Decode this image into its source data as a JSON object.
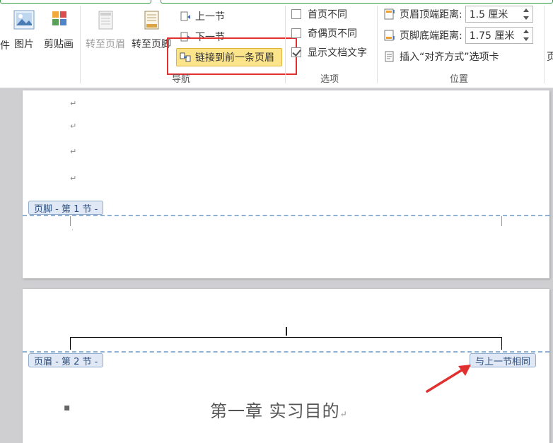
{
  "ribbon": {
    "left_cut": "件",
    "insert_group": {
      "picture_label": "图片",
      "clipart_label": "剪贴画"
    },
    "nav_group": {
      "goto_header_label": "转至页眉",
      "goto_footer_label": "转至页脚",
      "prev_section_label": "上一节",
      "next_section_label": "下一节",
      "link_previous_label": "链接到前一条页眉",
      "group_label": "导航"
    },
    "options_group": {
      "first_page_label": "首页不同",
      "odd_even_label": "奇偶页不同",
      "show_text_label": "显示文档文字",
      "group_label": "选项"
    },
    "position_group": {
      "header_top_label": "页眉顶端距离:",
      "header_top_value": "1.5 厘米",
      "footer_bottom_label": "页脚底端距离:",
      "footer_bottom_value": "1.75 厘米",
      "insert_align_tab_label": "插入“对齐方式”选项卡",
      "group_label": "位置"
    },
    "right_cut": "页"
  },
  "document": {
    "para_mark": "↵",
    "footer_tab_label": "页脚 - 第 1 节 -",
    "header_tab_label": "页眉 - 第 2 节 -",
    "same_as_previous_label": "与上一节相同",
    "chapter_title": "第一章  实习目的",
    "chapter_mark": "↵"
  },
  "colors": {
    "highlight_fill": "#fce48a",
    "annotation_red": "#e03030",
    "tab_fill": "#dfe8f4",
    "dash_line": "#8eb2d6"
  }
}
